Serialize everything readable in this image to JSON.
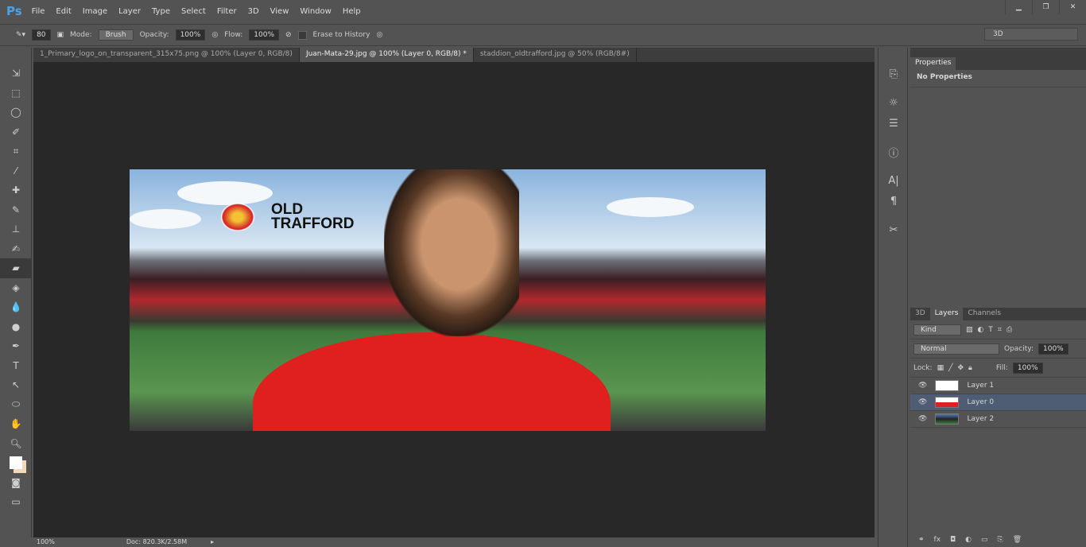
{
  "app": {
    "logo": "Ps",
    "menu": [
      "File",
      "Edit",
      "Image",
      "Layer",
      "Type",
      "Select",
      "Filter",
      "3D",
      "View",
      "Window",
      "Help"
    ],
    "window_buttons": [
      "minimize",
      "restore",
      "close"
    ]
  },
  "options": {
    "brush_size": "80",
    "mode_label": "Mode:",
    "mode": "Brush",
    "opacity_label": "Opacity:",
    "opacity": "100%",
    "flow_label": "Flow:",
    "flow": "100%",
    "erase_history": "Erase to History",
    "workspace": "3D"
  },
  "tabs": [
    {
      "label": "1_Primary_logo_on_transparent_315x75.png @ 100% (Layer 0, RGB/8)",
      "active": false
    },
    {
      "label": "Juan-Mata-29.jpg @ 100% (Layer 0, RGB/8) *",
      "active": true
    },
    {
      "label": "staddion_oldtrafford.jpg @ 50% (RGB/8#)",
      "active": false
    }
  ],
  "tools": [
    "move",
    "marquee",
    "lasso",
    "quick-select",
    "crop",
    "eyedropper",
    "healing",
    "brush",
    "stamp",
    "history-brush",
    "eraser",
    "paint-bucket",
    "blur",
    "dodge",
    "pen",
    "type",
    "path-select",
    "shape",
    "hand",
    "zoom"
  ],
  "image_text": {
    "brand": "OLD TRAFFORD"
  },
  "status": {
    "zoom": "100%",
    "doc": "Doc: 820.3K/2.58M"
  },
  "properties": {
    "tab": "Properties",
    "text": "No Properties"
  },
  "layers_panel": {
    "tabs": [
      "3D",
      "Layers",
      "Channels"
    ],
    "active_tab": "Layers",
    "kind": "Kind",
    "blend": "Normal",
    "opacity_label": "Opacity:",
    "opacity": "100%",
    "lock_label": "Lock:",
    "fill_label": "Fill:",
    "fill": "100%",
    "layers": [
      {
        "name": "Layer 1",
        "selected": false
      },
      {
        "name": "Layer 0",
        "selected": true
      },
      {
        "name": "Layer 2",
        "selected": false
      }
    ]
  },
  "colors": {
    "accent": "#4aa3e8",
    "selected_layer": "#4e5d74"
  }
}
